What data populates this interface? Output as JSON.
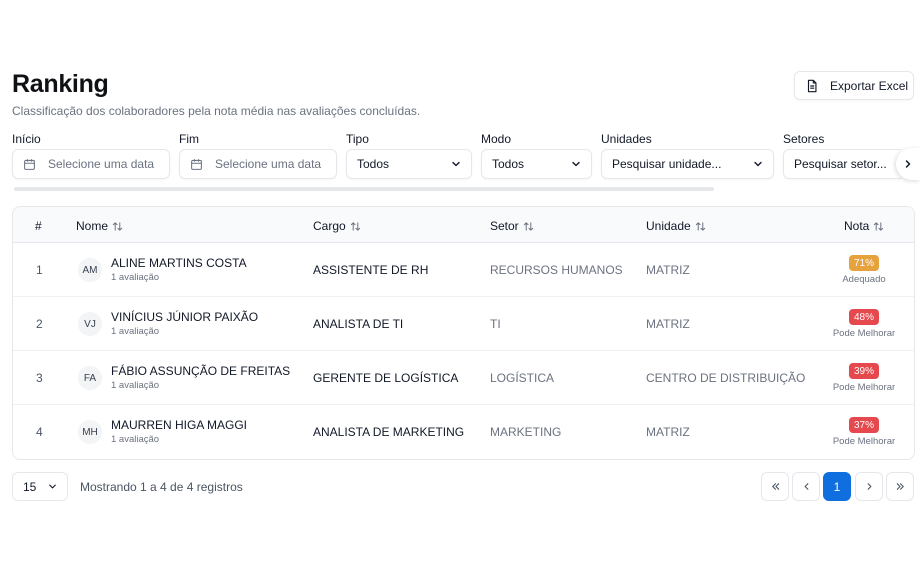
{
  "header": {
    "title": "Ranking",
    "subtitle": "Classificação dos colaboradores pela nota média nas avaliações concluídas.",
    "export_label": "Exportar Excel"
  },
  "filters": {
    "inicio": {
      "label": "Início",
      "placeholder": "Selecione uma data"
    },
    "fim": {
      "label": "Fim",
      "placeholder": "Selecione uma data"
    },
    "tipo": {
      "label": "Tipo",
      "value": "Todos"
    },
    "modo": {
      "label": "Modo",
      "value": "Todos"
    },
    "unidades": {
      "label": "Unidades",
      "value": "Pesquisar unidade..."
    },
    "setores": {
      "label": "Setores",
      "value": "Pesquisar setor..."
    }
  },
  "table": {
    "columns": {
      "idx": "#",
      "nome": "Nome",
      "cargo": "Cargo",
      "setor": "Setor",
      "unidade": "Unidade",
      "nota": "Nota"
    },
    "rows": [
      {
        "idx": "1",
        "initials": "AM",
        "name": "ALINE MARTINS COSTA",
        "evals": "1 avaliação",
        "cargo": "ASSISTENTE DE RH",
        "setor": "RECURSOS HUMANOS",
        "unidade": "MATRIZ",
        "nota": "71%",
        "nota_label": "Adequado",
        "nota_color": "#e6a23c"
      },
      {
        "idx": "2",
        "initials": "VJ",
        "name": "VINÍCIUS JÚNIOR PAIXÃO",
        "evals": "1 avaliação",
        "cargo": "ANALISTA DE TI",
        "setor": "TI",
        "unidade": "MATRIZ",
        "nota": "48%",
        "nota_label": "Pode Melhorar",
        "nota_color": "#e5484d"
      },
      {
        "idx": "3",
        "initials": "FA",
        "name": "FÁBIO ASSUNÇÃO DE FREITAS",
        "evals": "1 avaliação",
        "cargo": "GERENTE DE LOGÍSTICA",
        "setor": "LOGÍSTICA",
        "unidade": "CENTRO DE DISTRIBUIÇÃO",
        "nota": "39%",
        "nota_label": "Pode Melhorar",
        "nota_color": "#e5484d"
      },
      {
        "idx": "4",
        "initials": "MH",
        "name": "MAURREN HIGA MAGGI",
        "evals": "1 avaliação",
        "cargo": "ANALISTA DE MARKETING",
        "setor": "MARKETING",
        "unidade": "MATRIZ",
        "nota": "37%",
        "nota_label": "Pode Melhorar",
        "nota_color": "#e5484d"
      }
    ]
  },
  "pagination": {
    "per_page": "15",
    "showing": "Mostrando 1 a 4 de 4 registros",
    "current_page": "1"
  },
  "colors": {
    "accent": "#0f6fde",
    "warning": "#e6a23c",
    "danger": "#e5484d"
  }
}
